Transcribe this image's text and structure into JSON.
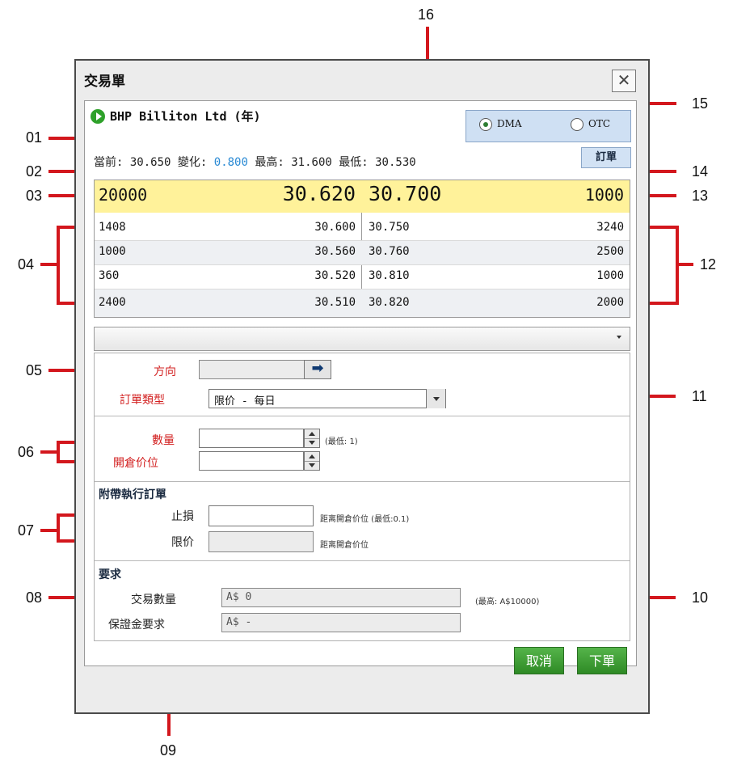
{
  "callouts": [
    "01",
    "02",
    "03",
    "04",
    "05",
    "06",
    "07",
    "08",
    "09",
    "10",
    "11",
    "12",
    "13",
    "14",
    "15",
    "16"
  ],
  "window": {
    "title": "交易單",
    "close_symbol": "✕"
  },
  "instrument": {
    "name": "BHP Billiton Ltd (年)",
    "icon": "play-icon"
  },
  "routing": {
    "options": [
      "DMA",
      "OTC"
    ],
    "selected": "DMA"
  },
  "stats": {
    "current_label": "當前:",
    "current_value": "30.650",
    "change_label": "變化:",
    "change_value": "0.800",
    "high_label": "最高:",
    "high_value": "31.600",
    "low_label": "最低:",
    "low_value": "30.530",
    "change_color": "#2a8ad4"
  },
  "order_button": "訂單",
  "order_book": {
    "best_bid_qty": "20000",
    "best_bid": "30.620",
    "best_ask": "30.700",
    "best_ask_qty": "1000",
    "highlight_color": "#fff29a",
    "rows": [
      {
        "bid_qty": "1408",
        "bid": "30.600",
        "ask": "30.750",
        "ask_qty": "3240"
      },
      {
        "bid_qty": "1000",
        "bid": "30.560",
        "ask": "30.760",
        "ask_qty": "2500"
      },
      {
        "bid_qty": "360",
        "bid": "30.520",
        "ask": "30.810",
        "ask_qty": "1000"
      },
      {
        "bid_qty": "2400",
        "bid": "30.510",
        "ask": "30.820",
        "ask_qty": "2000"
      }
    ]
  },
  "form": {
    "direction_label": "方向",
    "order_type_label": "訂單類型",
    "order_type_value": "限价 - 每日",
    "quantity_label": "數量",
    "quantity_hint": "(最低: 1)",
    "open_price_label": "開倉价位",
    "attached_title": "附帶執行訂單",
    "stop_label": "止損",
    "stop_hint": "距离開倉价位 (最低:0.1)",
    "limit_label": "限价",
    "limit_hint": "距离開倉价位",
    "requirements_title": "要求",
    "trade_qty_label": "交易數量",
    "trade_qty_value": "A$ 0",
    "trade_qty_hint": "(最高: A$10000)",
    "margin_label": "保證金要求",
    "margin_value": "A$ -"
  },
  "buttons": {
    "cancel": "取消",
    "submit": "下單"
  },
  "colors": {
    "label_red": "#d21f1f",
    "button_green": "#3a9b2f",
    "annotation_red": "#d3171d"
  }
}
